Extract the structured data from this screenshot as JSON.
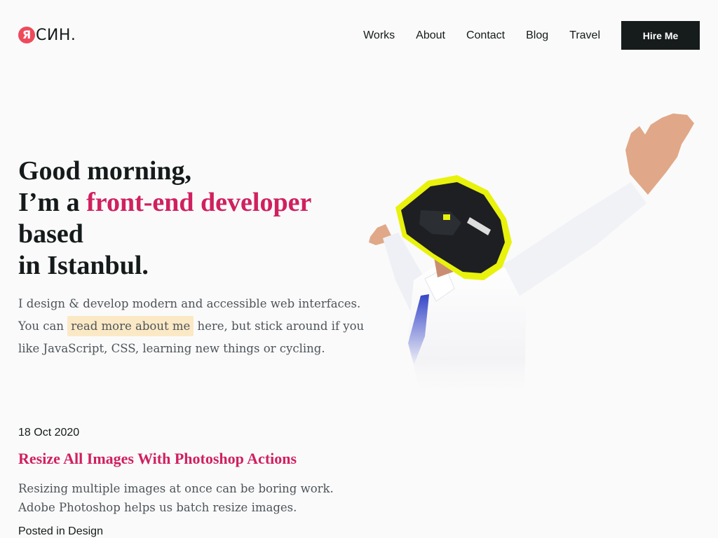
{
  "header": {
    "logo": {
      "mark": "Я",
      "text": "СИН."
    },
    "nav": [
      "Works",
      "About",
      "Contact",
      "Blog",
      "Travel"
    ],
    "hire_label": "Hire Me"
  },
  "hero": {
    "greeting": "Good morning,",
    "intro_prefix": "I’m a ",
    "role": "front-end developer",
    "line3": "based",
    "line4": "in Istanbul.",
    "desc_line1": "I design & develop modern and accessible web interfaces.",
    "desc_prefix": "You can ",
    "desc_link": "read more about me",
    "desc_suffix": " here, but stick around if you",
    "desc_line3": "like JavaScript, CSS, learning new things or cycling.",
    "image": "man-in-cycling-helmet-raising-arms"
  },
  "post": {
    "date": "18 Oct 2020",
    "title": "Resize All Images With Photoshop Actions",
    "excerpt_line1": "Resizing multiple images at once can be boring work.",
    "excerpt_line2": "Adobe Photoshop helps us batch resize images.",
    "category": "Posted in Design"
  },
  "colors": {
    "accent": "#d0205f",
    "logo": "#ee4a5c",
    "button": "#161b1b",
    "highlight": "#fbe9c6",
    "background": "#fafafa"
  }
}
